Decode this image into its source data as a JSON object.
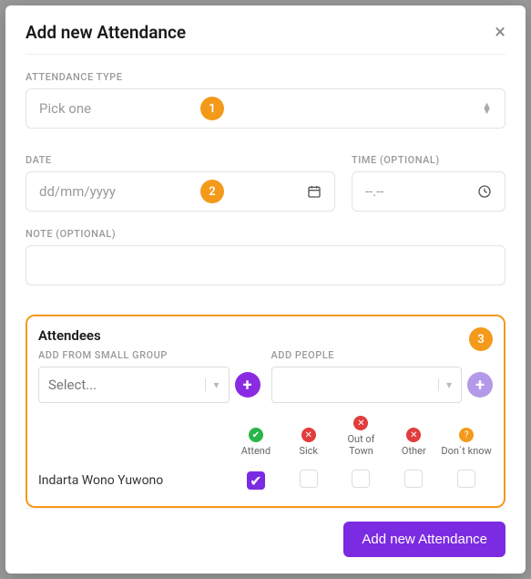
{
  "modal": {
    "title": "Add new Attendance"
  },
  "fields": {
    "type_label": "ATTENDANCE TYPE",
    "type_placeholder": "Pick one",
    "date_label": "DATE",
    "date_placeholder": "dd/mm/yyyy",
    "time_label": "TIME (OPTIONAL)",
    "time_placeholder": "--.--",
    "note_label": "NOTE (OPTIONAL)"
  },
  "badges": {
    "b1": "1",
    "b2": "2",
    "b3": "3"
  },
  "attendees": {
    "title": "Attendees",
    "group_label": "ADD FROM SMALL GROUP",
    "group_placeholder": "Select...",
    "people_label": "ADD PEOPLE",
    "statuses": {
      "attend": "Attend",
      "sick": "Sick",
      "oot": "Out of Town",
      "other": "Other",
      "dk": "Don`t know"
    },
    "rows": [
      {
        "name": "Indarta Wono Yuwono",
        "attend": true,
        "sick": false,
        "oot": false,
        "other": false,
        "dk": false
      }
    ]
  },
  "footer": {
    "submit": "Add new Attendance"
  }
}
